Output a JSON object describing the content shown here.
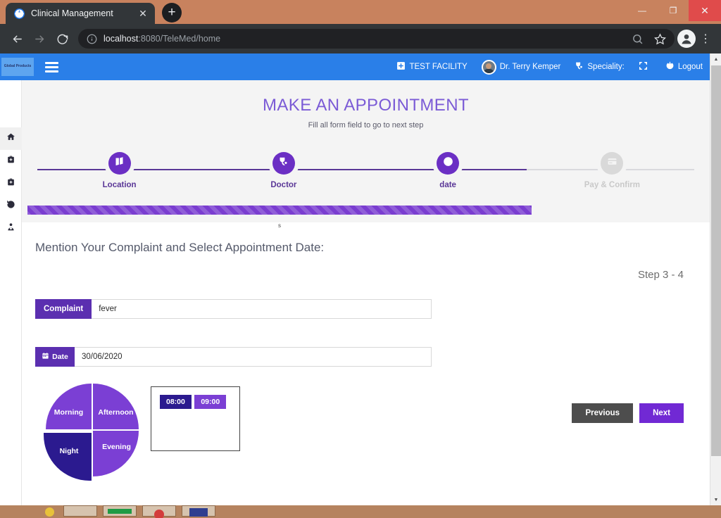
{
  "browser": {
    "tab": {
      "title": "Clinical Management",
      "favicon": "globe-icon",
      "close": "✕"
    },
    "newtab_label": "+",
    "window_controls": {
      "minimize": "—",
      "maximize": "❐",
      "close": "✕"
    },
    "omnibox": {
      "url_bold": "localhost",
      "url_rest": ":8080/TeleMed/home",
      "full_url": "localhost:8080/TeleMed/home"
    },
    "nav": {
      "back": "←",
      "forward": "→",
      "reload": "⟳"
    },
    "kebab": "⋮"
  },
  "appbar": {
    "brand_text": "Global Products",
    "items": [
      {
        "label": "TEST FACILITY",
        "icon": "plus-square-icon"
      },
      {
        "label": "Dr. Terry Kemper",
        "icon": "user-avatar"
      },
      {
        "label": "Speciality:",
        "icon": "stethoscope-icon"
      },
      {
        "label": "",
        "icon": "fullscreen-icon"
      },
      {
        "label": "Logout",
        "icon": "power-icon"
      }
    ]
  },
  "rail": {
    "items": [
      {
        "icon": "home-icon",
        "active": true
      },
      {
        "icon": "medical-kit-icon",
        "active": false
      },
      {
        "icon": "medical-kit-icon",
        "active": false
      },
      {
        "icon": "history-icon",
        "active": false
      },
      {
        "icon": "user-md-icon",
        "active": false
      }
    ]
  },
  "hero": {
    "title": "MAKE AN APPOINTMENT",
    "subtitle": "Fill all form field to go to next step"
  },
  "stepper": {
    "steps": [
      {
        "label": "Location",
        "icon": "map-icon",
        "state": "done"
      },
      {
        "label": "Doctor",
        "icon": "stethoscope-icon",
        "state": "done"
      },
      {
        "label": "date",
        "icon": "clock-icon",
        "state": "active"
      },
      {
        "label": "Pay & Confirm",
        "icon": "credit-card-icon",
        "state": "pending"
      }
    ],
    "progress_percent": 75,
    "progress_caption": "s"
  },
  "panel": {
    "title": "Mention Your Complaint and Select Appointment Date:",
    "step_counter": "Step 3 - 4",
    "complaint": {
      "label": "Complaint",
      "value": "fever",
      "placeholder": ""
    },
    "date": {
      "label": "Date",
      "icon": "calendar-icon",
      "value": "30/06/2020",
      "placeholder": ""
    },
    "buttons": {
      "previous": "Previous",
      "next": "Next"
    }
  },
  "chart_data": {
    "type": "pie",
    "title": "",
    "categories": [
      "Morning",
      "Afternoon",
      "Evening",
      "Night"
    ],
    "values": [
      25,
      25,
      25,
      25
    ],
    "selected": "Night",
    "colors": {
      "Morning": "#7b3fd4",
      "Afternoon": "#7b3fd4",
      "Evening": "#7b3fd4",
      "Night": "#2b1a8f"
    },
    "legend": "none"
  },
  "time_slots": {
    "items": [
      {
        "label": "08:00",
        "selected": true
      },
      {
        "label": "09:00",
        "selected": false
      }
    ]
  },
  "colors": {
    "accent_purple": "#7b3fd4",
    "deep_purple": "#5b2fb0",
    "dark_purple": "#2b1a8f",
    "brand_blue": "#2a7fe8",
    "title_purple": "#7b5bd6"
  }
}
